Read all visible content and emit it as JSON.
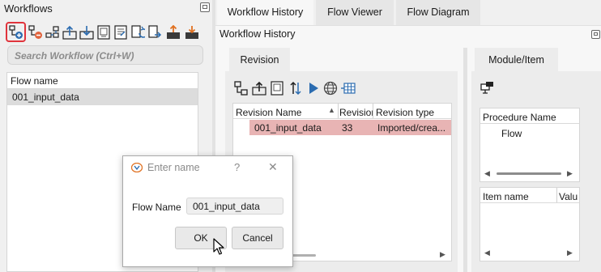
{
  "workflows_panel": {
    "title": "Workflows",
    "search_placeholder": "Search Workflow (Ctrl+W)",
    "list_header": "Flow name",
    "rows": [
      "001_input_data"
    ]
  },
  "main_tabs": [
    {
      "label": "Workflow History"
    },
    {
      "label": "Flow Viewer"
    },
    {
      "label": "Flow Diagram"
    }
  ],
  "history": {
    "title": "Workflow History",
    "revision_tab": "Revision",
    "module_tab": "Module/Item",
    "columns": [
      "Revision Name",
      "Revision",
      "Revision type"
    ],
    "rows": [
      {
        "name": "001_input_data",
        "revision": "33",
        "type": "Imported/crea..."
      }
    ],
    "procedure_header": "Procedure Name",
    "procedure_rows": [
      "Flow"
    ],
    "item_columns": [
      "Item name",
      "Valu"
    ]
  },
  "dialog": {
    "title": "Enter name",
    "help": "?",
    "close": "✕",
    "field_label": "Flow Name",
    "field_value": "001_input_data",
    "ok": "OK",
    "cancel": "Cancel"
  },
  "colors": {
    "selection_red": "#e8b4b4",
    "highlight_border": "#e0343c",
    "icon_blue": "#2b6cb0"
  }
}
